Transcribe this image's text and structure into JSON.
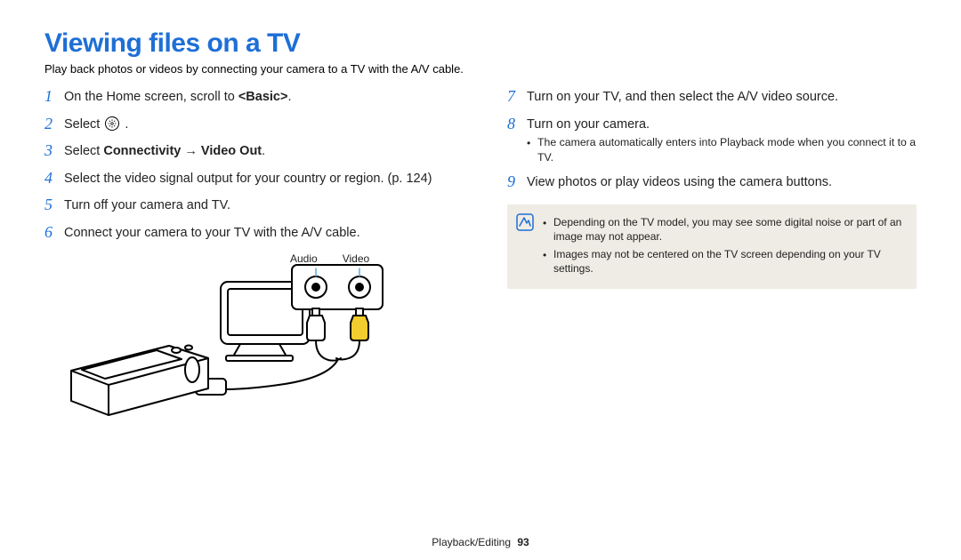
{
  "title": "Viewing files on a TV",
  "subtitle": "Play back photos or videos by connecting your camera to a TV with the A/V cable.",
  "steps_left": [
    {
      "num": "1",
      "pre": "On the Home screen, scroll to ",
      "bold": "<Basic>",
      "post": "."
    },
    {
      "num": "2",
      "pre": "Select ",
      "icon": true,
      "post": " ."
    },
    {
      "num": "3",
      "pre": "Select ",
      "bold": "Connectivity → Video Out",
      "post": ".",
      "all_bold": true
    },
    {
      "num": "4",
      "pre": "Select the video signal output for your country or region. (p. 124)"
    },
    {
      "num": "5",
      "pre": "Turn off your camera and TV."
    },
    {
      "num": "6",
      "pre": "Connect your camera to your TV with the A/V cable."
    }
  ],
  "steps_right": [
    {
      "num": "7",
      "pre": "Turn on your TV, and then select the A/V video source."
    },
    {
      "num": "8",
      "pre": "Turn on your camera.",
      "sub": [
        "The camera automatically enters into Playback mode when you connect it to a TV."
      ]
    },
    {
      "num": "9",
      "pre": "View photos or play videos using the camera buttons."
    }
  ],
  "notes": [
    "Depending on the TV model, you may see some digital noise or part of an image may not appear.",
    "Images may not be centered on the TV screen depending on your TV settings."
  ],
  "diagram": {
    "audio_label": "Audio",
    "video_label": "Video"
  },
  "footer": {
    "section": "Playback/Editing",
    "page": "93"
  }
}
